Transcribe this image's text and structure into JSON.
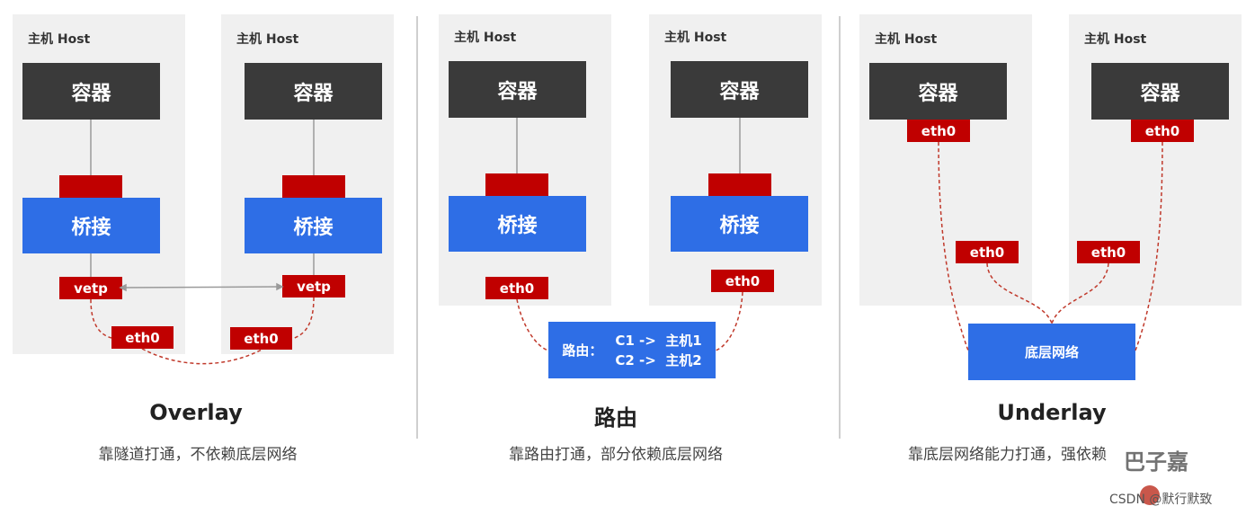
{
  "panels": [
    {
      "name": "overlay",
      "title": "Overlay",
      "subtitle": "靠隧道打通，不依赖底层网络",
      "hosts": [
        {
          "label": "主机 Host",
          "container": "容器",
          "bridge": "桥接",
          "vetp": "vetp",
          "eth0": "eth0"
        },
        {
          "label": "主机 Host",
          "container": "容器",
          "bridge": "桥接",
          "vetp": "vetp",
          "eth0": "eth0"
        }
      ]
    },
    {
      "name": "routing",
      "title": "路由",
      "subtitle": "靠路由打通，部分依赖底层网络",
      "hosts": [
        {
          "label": "主机 Host",
          "container": "容器",
          "bridge": "桥接",
          "eth0": "eth0"
        },
        {
          "label": "主机 Host",
          "container": "容器",
          "bridge": "桥接",
          "eth0": "eth0"
        }
      ],
      "route_table": {
        "label": "路由：",
        "rules": [
          "C1 ->  主机1",
          "C2 ->  主机2"
        ]
      }
    },
    {
      "name": "underlay",
      "title": "Underlay",
      "subtitle": "靠底层网络能力打通，强依赖",
      "hosts": [
        {
          "label": "主机 Host",
          "container": "容器",
          "container_eth0": "eth0",
          "host_eth0": "eth0"
        },
        {
          "label": "主机 Host",
          "container": "容器",
          "container_eth0": "eth0",
          "host_eth0": "eth0"
        }
      ],
      "underlay_network": "底层网络"
    }
  ],
  "watermark": {
    "logo_text": "巴子嘉",
    "credit": "CSDN @默行默致"
  },
  "colors": {
    "container": "#3a3a3a",
    "bridge": "#2e6ee6",
    "interface": "#c00000",
    "host_bg": "#f0f0f0"
  }
}
